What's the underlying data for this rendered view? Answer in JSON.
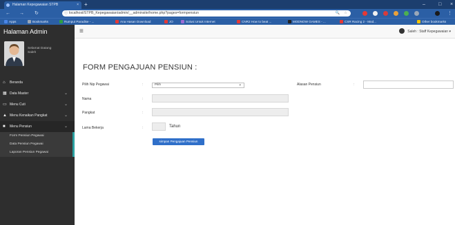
{
  "browser": {
    "tab_title": "Halaman Kepegawaian STPB",
    "tab_close": "×",
    "new_tab": "+",
    "url": "localhost/STPB_Kepegawaian/admin/__adminsite/home.php?pages=formpensiun",
    "bookmarks": [
      {
        "label": "Apps",
        "color": "#4a86e8"
      },
      {
        "label": "Bookmarks",
        "color": "#9aa7b8"
      },
      {
        "label": "Rumput Paradise - ...",
        "color": "#2e9e44"
      },
      {
        "label": "Ana Hasan Download",
        "color": "#e53935"
      },
      {
        "label": "JO",
        "color": "#e53935"
      },
      {
        "label": "Solusi Untuk Internet",
        "color": "#9c6cd4"
      },
      {
        "label": "CNR2 How to beat ...",
        "color": "#e53935"
      },
      {
        "label": "MODNOW GAMES - ...",
        "color": "#222222"
      },
      {
        "label": "CSR Racing 2 - Mod...",
        "color": "#e53935"
      },
      {
        "label": "Other bookmarks",
        "color": "#f2c200"
      }
    ]
  },
  "app": {
    "brand": "Halaman Admin",
    "user_label": "Saleh : Staff Kepegawaian"
  },
  "sidebar": {
    "welcome_line1": "Selamat Datang",
    "welcome_line2": "Saleh",
    "menu": [
      {
        "label": "Beranda",
        "icon": "home-icon",
        "has_children": false
      },
      {
        "label": "Data Master",
        "icon": "table-icon",
        "has_children": true
      },
      {
        "label": "Menu Cuti",
        "icon": "monitor-icon",
        "has_children": true
      },
      {
        "label": "Menu Kenaikan Pangkat",
        "icon": "graduation-cap-icon",
        "has_children": true
      },
      {
        "label": "Menu Pensiun",
        "icon": "book-icon",
        "has_children": true
      }
    ],
    "submenu": [
      "Form Pensiun Pegawai",
      "Data Pensiun Pegawai",
      "Laporan Pensiun Pegawai"
    ]
  },
  "form": {
    "title": "FORM PENGAJUAN PENSIUN :",
    "nip_label": "Pilih Nip Pegawai",
    "nip_selected": "Pilih",
    "nama_label": "Nama",
    "pangkat_label": "Pangkat",
    "lama_label": "Lama Bekerja",
    "lama_unit": "Tahun",
    "alasan_label": "Alasan Pensiun",
    "colon": ":",
    "submit_label": "simpan Pengajuan Pensiun"
  }
}
